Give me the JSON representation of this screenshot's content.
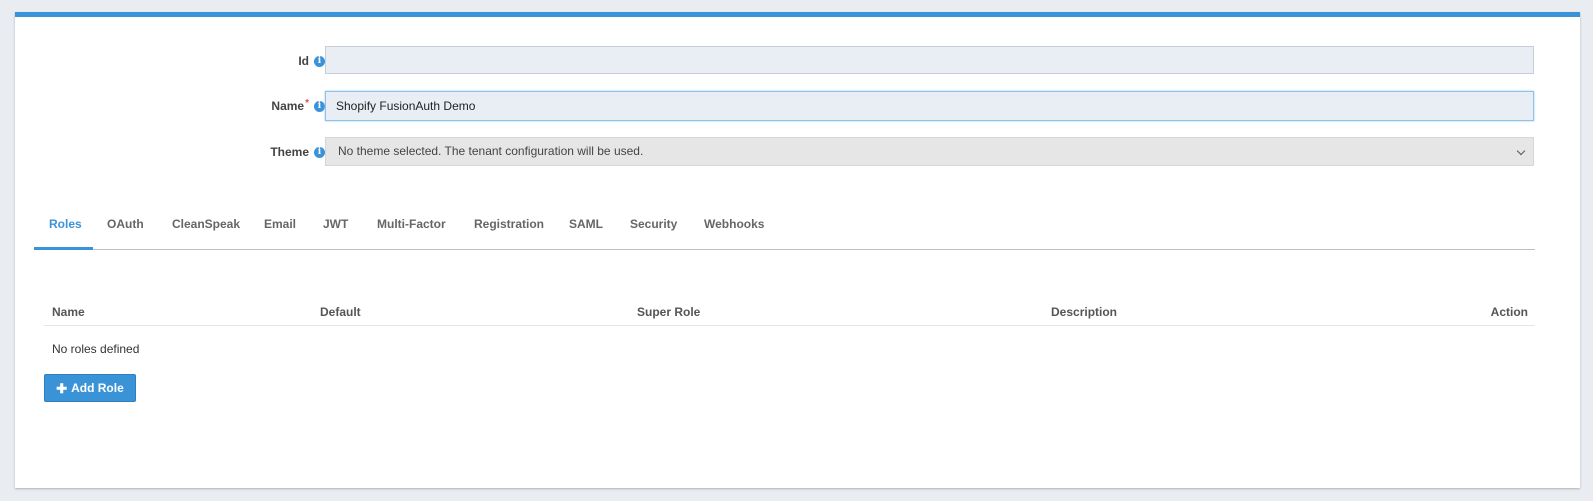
{
  "form": {
    "id": {
      "label": "Id",
      "value": "",
      "icon": "info-icon"
    },
    "name": {
      "label": "Name",
      "required_mark": "*",
      "value": "Shopify FusionAuth Demo",
      "icon": "info-icon"
    },
    "theme": {
      "label": "Theme",
      "selected": "No theme selected. The tenant configuration will be used.",
      "icon": "info-icon"
    }
  },
  "tabs": [
    {
      "label": "Roles",
      "active": true
    },
    {
      "label": "OAuth"
    },
    {
      "label": "CleanSpeak"
    },
    {
      "label": "Email"
    },
    {
      "label": "JWT"
    },
    {
      "label": "Multi-Factor"
    },
    {
      "label": "Registration"
    },
    {
      "label": "SAML"
    },
    {
      "label": "Security"
    },
    {
      "label": "Webhooks"
    }
  ],
  "roles_table": {
    "columns": [
      "Name",
      "Default",
      "Super Role",
      "Description",
      "Action"
    ],
    "empty_message": "No roles defined"
  },
  "add_role_button": {
    "label": "Add Role",
    "icon": "plus-icon"
  },
  "colors": {
    "accent": "#3b93d7",
    "background": "#e9ecf1"
  }
}
